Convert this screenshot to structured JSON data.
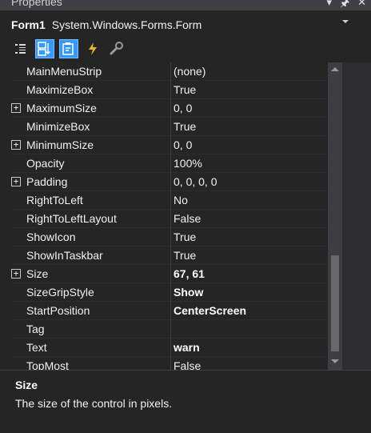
{
  "window": {
    "title": "Properties",
    "pin_icon": "pin-icon",
    "close_icon": "close-icon",
    "dropdown_icon": "chevron-down-icon"
  },
  "object_selector": {
    "name": "Form1",
    "type": "System.Windows.Forms.Form"
  },
  "toolbar": {
    "buttons": [
      {
        "icon": "categorized-icon",
        "active": false
      },
      {
        "icon": "alphabetical-icon",
        "active": true
      },
      {
        "icon": "properties-icon",
        "active": true
      },
      {
        "icon": "events-lightning-icon",
        "active": false
      },
      {
        "icon": "property-pages-wrench-icon",
        "active": false
      }
    ]
  },
  "properties": [
    {
      "name": "MainMenuStrip",
      "value": "(none)",
      "expandable": false,
      "bold": false
    },
    {
      "name": "MaximizeBox",
      "value": "True",
      "expandable": false,
      "bold": false
    },
    {
      "name": "MaximumSize",
      "value": "0, 0",
      "expandable": true,
      "bold": false
    },
    {
      "name": "MinimizeBox",
      "value": "True",
      "expandable": false,
      "bold": false
    },
    {
      "name": "MinimumSize",
      "value": "0, 0",
      "expandable": true,
      "bold": false
    },
    {
      "name": "Opacity",
      "value": "100%",
      "expandable": false,
      "bold": false
    },
    {
      "name": "Padding",
      "value": "0, 0, 0, 0",
      "expandable": true,
      "bold": false
    },
    {
      "name": "RightToLeft",
      "value": "No",
      "expandable": false,
      "bold": false
    },
    {
      "name": "RightToLeftLayout",
      "value": "False",
      "expandable": false,
      "bold": false
    },
    {
      "name": "ShowIcon",
      "value": "True",
      "expandable": false,
      "bold": false
    },
    {
      "name": "ShowInTaskbar",
      "value": "True",
      "expandable": false,
      "bold": false
    },
    {
      "name": "Size",
      "value": "67, 61",
      "expandable": true,
      "bold": true
    },
    {
      "name": "SizeGripStyle",
      "value": "Show",
      "expandable": false,
      "bold": true
    },
    {
      "name": "StartPosition",
      "value": "CenterScreen",
      "expandable": false,
      "bold": true
    },
    {
      "name": "Tag",
      "value": "",
      "expandable": false,
      "bold": false
    },
    {
      "name": "Text",
      "value": "warn",
      "expandable": false,
      "bold": true
    },
    {
      "name": "TopMost",
      "value": "False",
      "expandable": false,
      "bold": false
    }
  ],
  "expander_symbol": "+",
  "description": {
    "title": "Size",
    "text": "The size of the control in pixels."
  },
  "colors": {
    "background": "#252526",
    "accent": "#3399ff",
    "text": "#f1f1f1"
  }
}
